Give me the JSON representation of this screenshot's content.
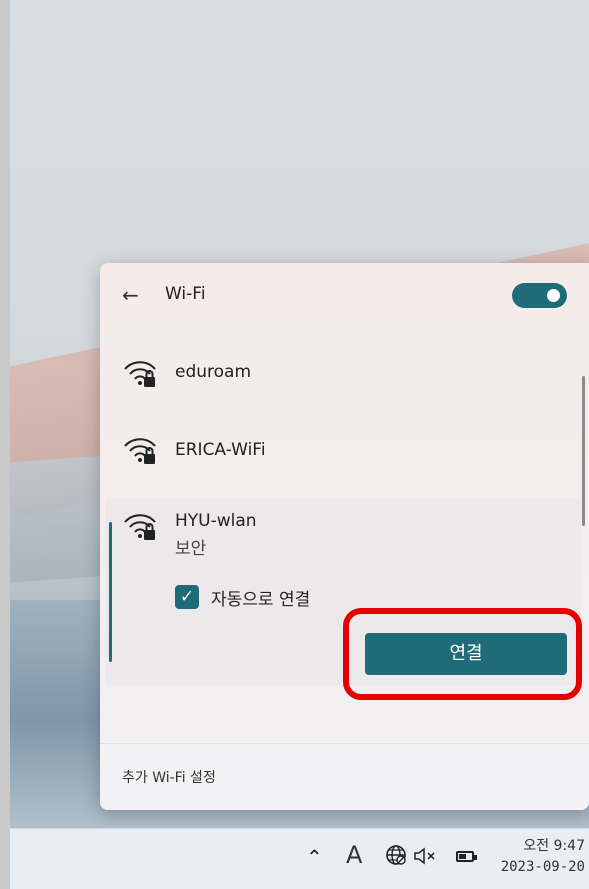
{
  "wifi_panel": {
    "back_icon": "arrow-left-icon",
    "title": "Wi-Fi",
    "toggle_on": true,
    "networks": [
      {
        "name": "eduroam",
        "icon": "wifi-secured-icon"
      },
      {
        "name": "ERICA-WiFi",
        "icon": "wifi-secured-icon"
      },
      {
        "name": "HYU-wlan",
        "status": "보안",
        "icon": "wifi-secured-icon",
        "selected": true
      }
    ],
    "auto_connect_label": "자동으로 연결",
    "auto_connect_checked": true,
    "connect_button": "연결",
    "more_settings": "추가 Wi-Fi 설정"
  },
  "taskbar": {
    "chevron_icon": "chevron-up-icon",
    "ime": "A",
    "network_icon": "globe-icon",
    "sound_icon": "speaker-muted-icon",
    "battery_icon": "battery-icon",
    "time": "오전 9:47",
    "date": "2023-09-20"
  },
  "colors": {
    "accent": "#1f6b78",
    "highlight": "#e60000"
  }
}
